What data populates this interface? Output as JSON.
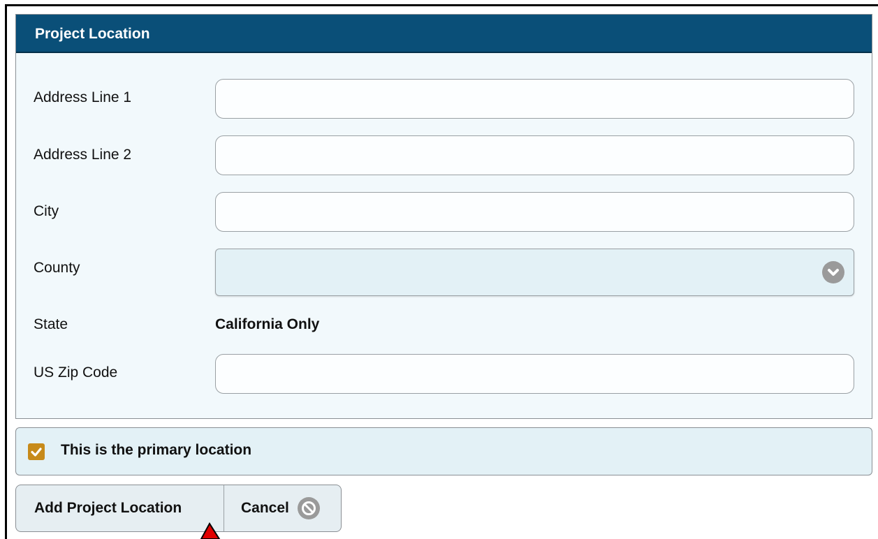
{
  "panel": {
    "title": "Project Location"
  },
  "fields": {
    "address1": {
      "label": "Address Line 1",
      "value": ""
    },
    "address2": {
      "label": "Address Line 2",
      "value": ""
    },
    "city": {
      "label": "City",
      "value": ""
    },
    "county": {
      "label": "County",
      "value": ""
    },
    "state": {
      "label": "State",
      "value": "California Only"
    },
    "zip": {
      "label": "US Zip Code",
      "value": ""
    }
  },
  "primary": {
    "label": "This is the primary location",
    "checked": true
  },
  "buttons": {
    "add": "Add Project Location",
    "cancel": "Cancel"
  },
  "icons": {
    "county_dropdown": "chevron-down-icon",
    "cancel": "cancel-circle-icon",
    "checkbox": "checkmark-icon",
    "pointer": "red-pointer-arrow-icon"
  },
  "colors": {
    "header_bg": "#0a4f78",
    "checkbox": "#c78a1a",
    "arrow": "#e00000"
  }
}
